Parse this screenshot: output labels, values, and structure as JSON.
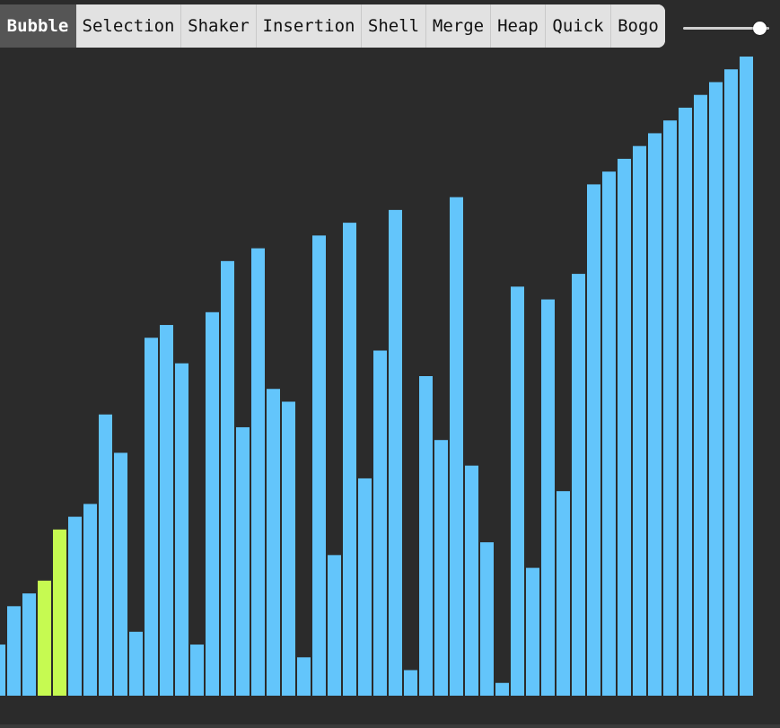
{
  "toolbar": {
    "tabs": [
      {
        "label": "Bubble",
        "active": true
      },
      {
        "label": "Selection",
        "active": false
      },
      {
        "label": "Shaker",
        "active": false
      },
      {
        "label": "Insertion",
        "active": false
      },
      {
        "label": "Shell",
        "active": false
      },
      {
        "label": "Merge",
        "active": false
      },
      {
        "label": "Heap",
        "active": false
      },
      {
        "label": "Quick",
        "active": false
      },
      {
        "label": "Bogo",
        "active": false
      }
    ]
  },
  "speed_slider": {
    "value": 0.97
  },
  "colors": {
    "background": "#2b2b2b",
    "bar": "#63c5fb",
    "bar_highlight": "#c6fa51",
    "tab_active_bg": "#555555",
    "tab_bg": "#e2e2e2"
  },
  "chart_data": {
    "type": "bar",
    "values": [
      4,
      7,
      8,
      9,
      13,
      14,
      15,
      22,
      19,
      5,
      28,
      29,
      26,
      4,
      30,
      34,
      21,
      35,
      24,
      23,
      3,
      36,
      11,
      37,
      17,
      27,
      38,
      2,
      25,
      20,
      39,
      18,
      12,
      1,
      32,
      10,
      31,
      16,
      33,
      40,
      41,
      42,
      43,
      44,
      45,
      46,
      47,
      48,
      49,
      50
    ],
    "highlight_indices": [
      3,
      4
    ],
    "ylim": [
      0,
      50
    ]
  }
}
